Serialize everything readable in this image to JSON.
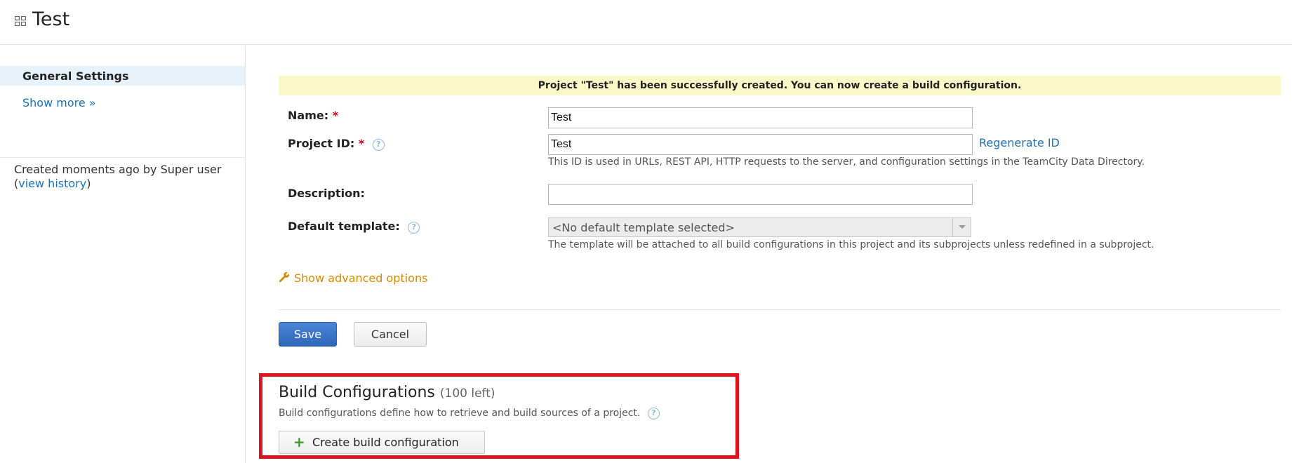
{
  "header": {
    "title": "Test"
  },
  "sidebar": {
    "active_item": "General Settings",
    "show_more": "Show more »",
    "created_text": "Created moments ago by Super user",
    "paren_open": "(",
    "view_history": "view history",
    "paren_close": ")"
  },
  "banner": {
    "text": "Project \"Test\" has been successfully created. You can now create a build configuration."
  },
  "form": {
    "name_label": "Name:",
    "name_value": "Test",
    "project_id_label": "Project ID:",
    "project_id_value": "Test",
    "regenerate_id": "Regenerate ID",
    "project_id_note": "This ID is used in URLs, REST API, HTTP requests to the server, and configuration settings in the TeamCity Data Directory.",
    "description_label": "Description:",
    "description_value": "",
    "default_template_label": "Default template:",
    "default_template_value": "<No default template selected>",
    "default_template_note": "The template will be attached to all build configurations in this project and its subprojects unless redefined in a subproject.",
    "required_mark": "*",
    "help_glyph": "?",
    "show_advanced": "Show advanced options",
    "save": "Save",
    "cancel": "Cancel"
  },
  "build_configurations": {
    "title": "Build Configurations",
    "left_count": "(100 left)",
    "description": "Build configurations define how to retrieve and build sources of a project.",
    "create_button": "Create build configuration",
    "create_plus": "+"
  },
  "colors": {
    "accent": "#1a72b8",
    "highlight_box": "#e0141c",
    "banner_bg": "#fbf8c8",
    "advanced_link": "#d48a00"
  },
  "icons": [
    "project-grid-icon",
    "help-icon",
    "wrench-icon",
    "dropdown-arrow-icon",
    "plus-icon"
  ]
}
